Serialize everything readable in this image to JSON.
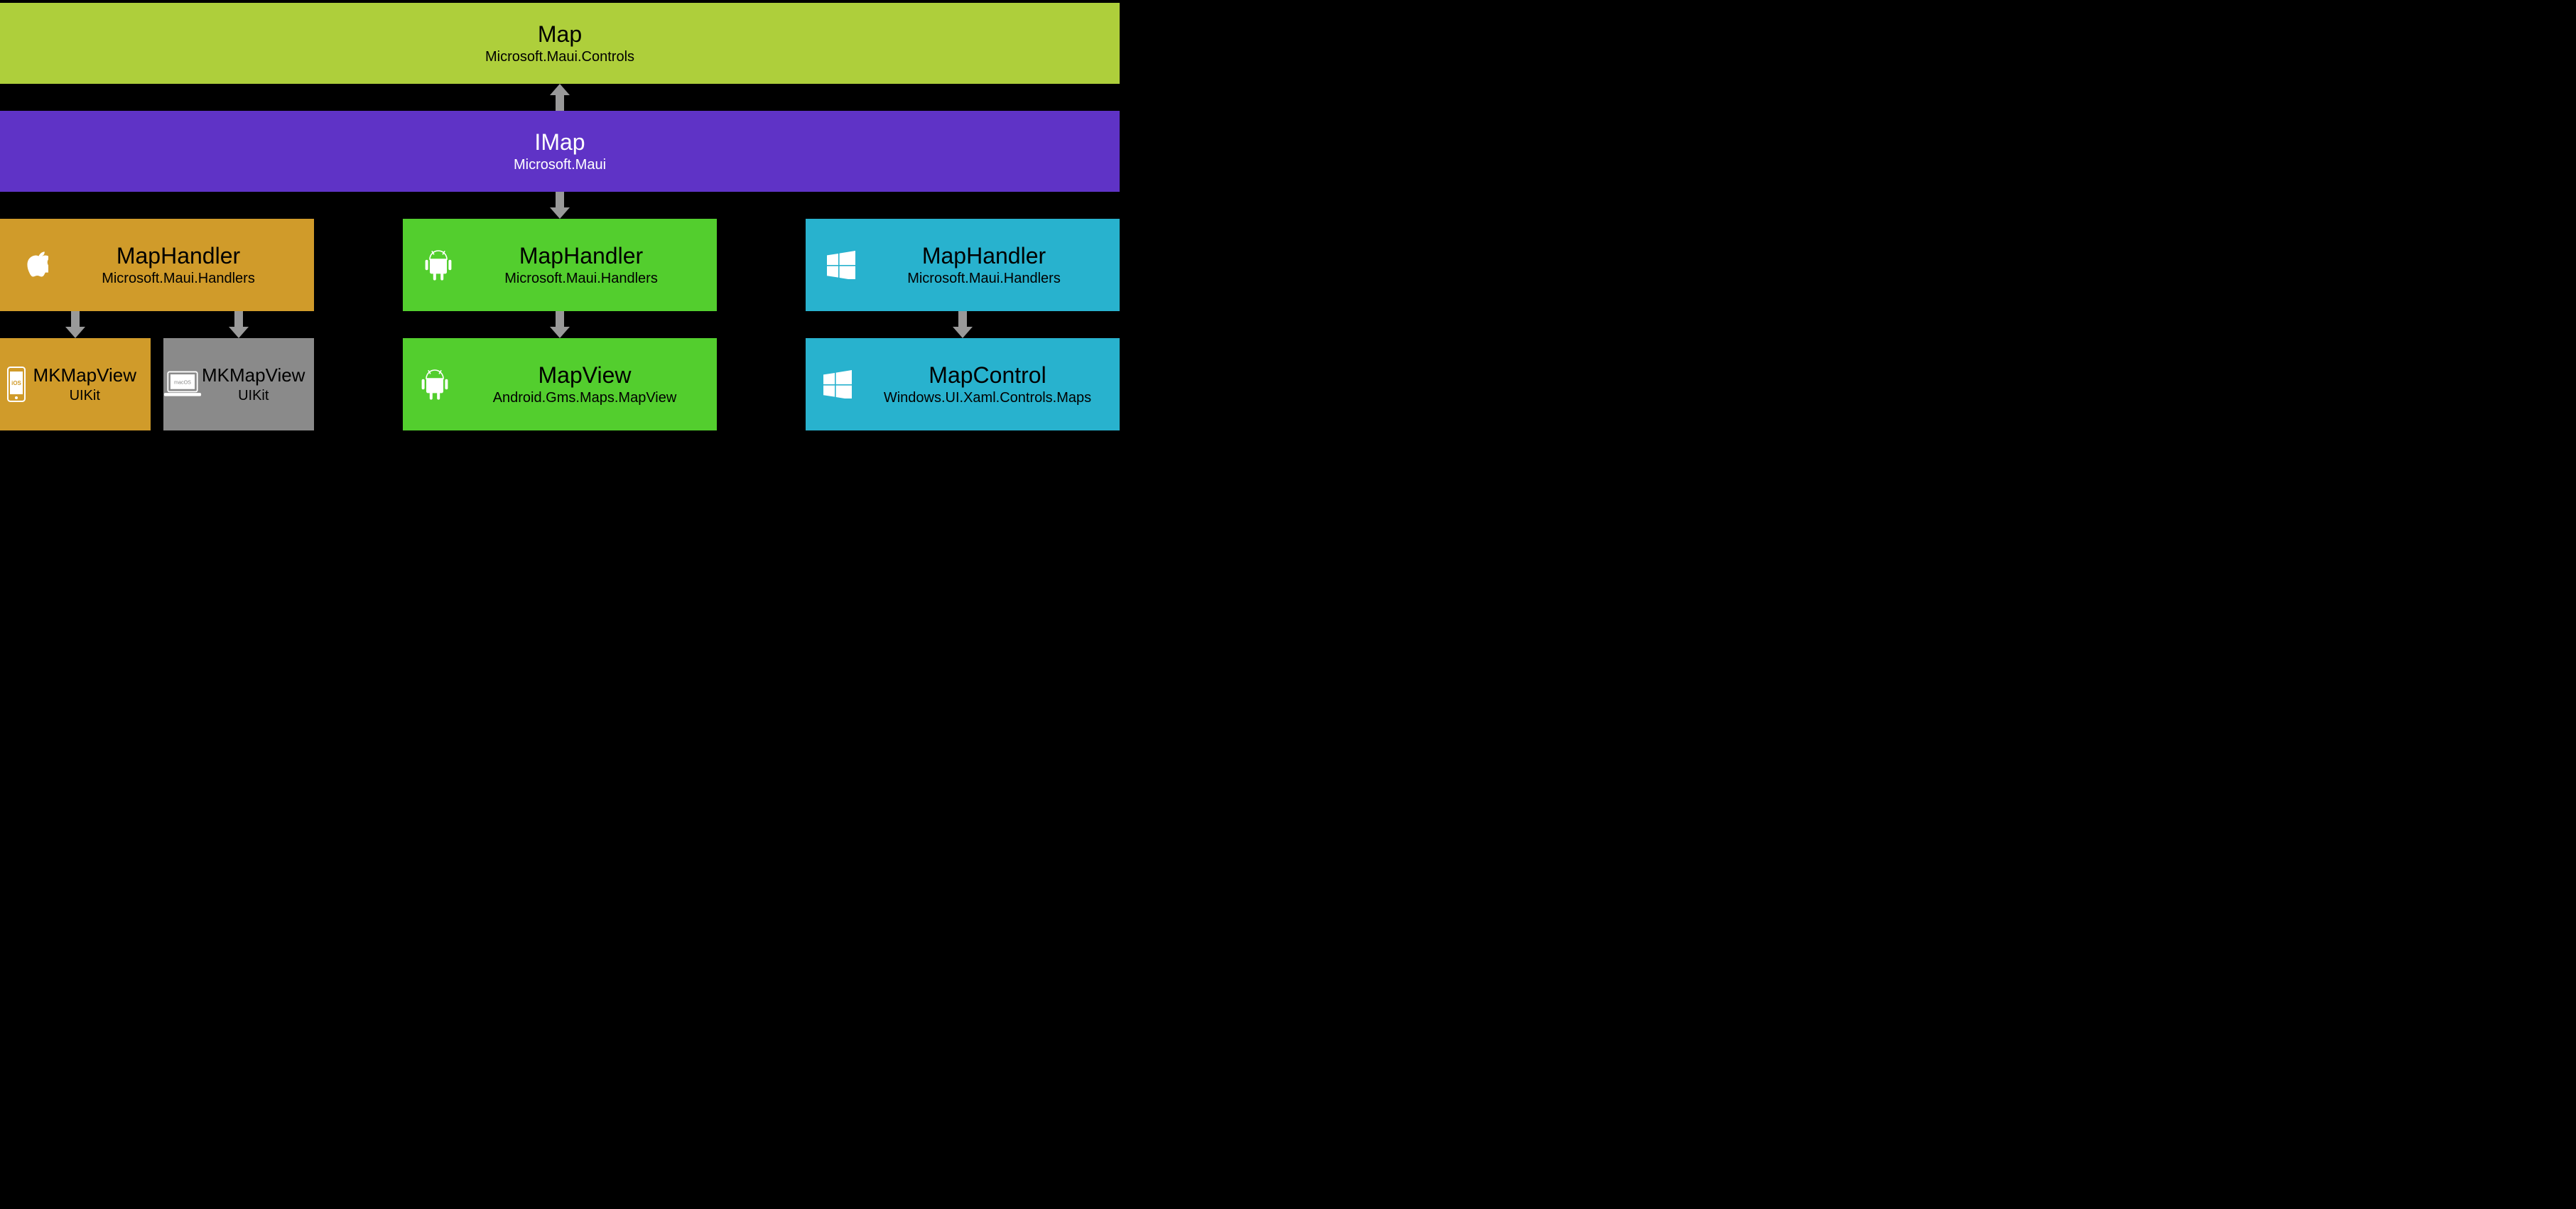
{
  "map": {
    "title": "Map",
    "subtitle": "Microsoft.Maui.Controls"
  },
  "imap": {
    "title": "IMap",
    "subtitle": "Microsoft.Maui"
  },
  "handlers": {
    "apple": {
      "title": "MapHandler",
      "subtitle": "Microsoft.Maui.Handlers",
      "icon": "apple-icon"
    },
    "android": {
      "title": "MapHandler",
      "subtitle": "Microsoft.Maui.Handlers",
      "icon": "android-icon"
    },
    "windows": {
      "title": "MapHandler",
      "subtitle": "Microsoft.Maui.Handlers",
      "icon": "windows-icon"
    }
  },
  "natives": {
    "ios": {
      "title": "MKMapView",
      "subtitle": "UIKit",
      "icon": "ios-phone-icon",
      "badge": "iOS"
    },
    "macos": {
      "title": "MKMapView",
      "subtitle": "UIKit",
      "icon": "macos-laptop-icon",
      "badge": "macOS"
    },
    "android": {
      "title": "MapView",
      "subtitle": "Android.Gms.Maps.MapView",
      "icon": "android-icon"
    },
    "windows": {
      "title": "MapControl",
      "subtitle": "Windows.UI.Xaml.Controls.Maps",
      "icon": "windows-icon"
    }
  },
  "colors": {
    "map": "#aecf3b",
    "imap": "#5f33c6",
    "apple": "#d09b2a",
    "macos": "#8a8a8a",
    "android": "#53ce2e",
    "windows": "#28b2ce",
    "arrow": "#999999"
  }
}
